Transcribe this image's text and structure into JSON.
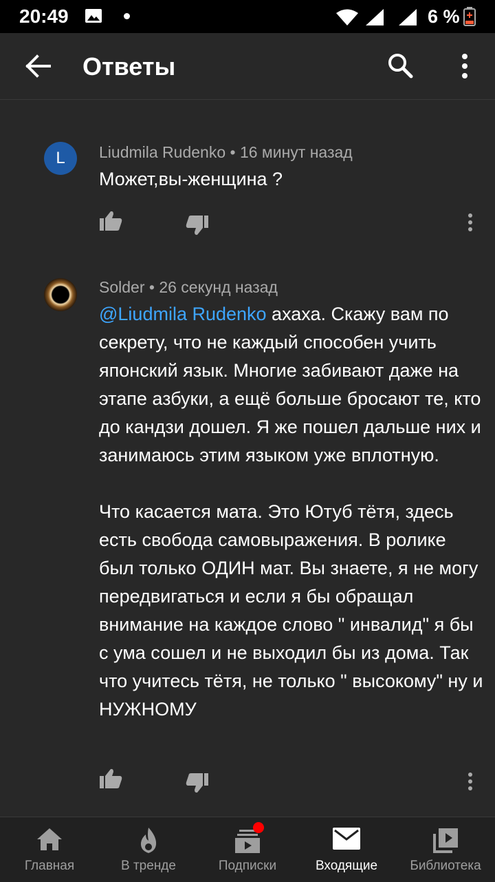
{
  "status_bar": {
    "time": "20:49",
    "battery_text": "6 %"
  },
  "app_bar": {
    "title": "Ответы",
    "icons": [
      "back-arrow-icon",
      "search-icon",
      "more-vert-icon"
    ]
  },
  "comments": [
    {
      "avatar_letter": "L",
      "avatar_color": "#1e5aa6",
      "meta": "Liudmila Rudenko • 16 минут назад",
      "text": "Может,вы-женщина ?"
    },
    {
      "meta": "Solder • 26 секунд назад",
      "mention": "@Liudmila Rudenko",
      "text_p1_after_mention": " ахаха. Скажу вам по секрету, что не каждый способен учить японский язык. Многие забивают даже на этапе  азбуки, а ещё больше бросают те, кто до кандзи дошел. Я же пошел дальше них и занимаюсь этим языком уже вплотную.",
      "text_p2": "Что касается мата. Это Ютуб тётя, здесь есть свобода самовыражения. В ролике был только ОДИН мат. Вы знаете, я не могу передвигаться и если я бы обращал внимание на каждое слово \" инвалид\" я бы с ума сошел и не выходил бы из дома. Так что учитесь тётя, не только \" высокому\" ну и НУЖНОМУ"
    }
  ],
  "bottom_nav": {
    "items": [
      {
        "label": "Главная",
        "icon": "home-icon"
      },
      {
        "label": "В тренде",
        "icon": "trending-flame-icon"
      },
      {
        "label": "Подписки",
        "icon": "subscriptions-icon"
      },
      {
        "label": "Входящие",
        "icon": "inbox-mail-icon"
      },
      {
        "label": "Библиотека",
        "icon": "library-icon"
      }
    ],
    "active_index": 3,
    "accent_color": "#ff0000"
  }
}
